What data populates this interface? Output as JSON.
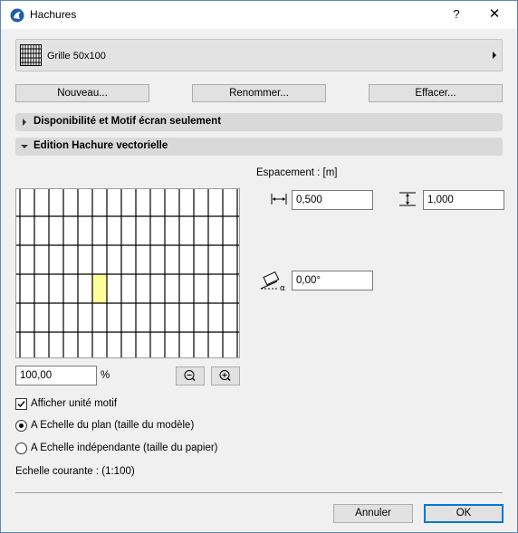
{
  "window": {
    "title": "Hachures",
    "help_label": "?",
    "close_label": "✕"
  },
  "pattern": {
    "name": "Grille 50x100"
  },
  "actions": {
    "new_label": "Nouveau...",
    "rename_label": "Renommer...",
    "delete_label": "Effacer..."
  },
  "sections": {
    "availability": "Disponibilité et Motif écran seulement",
    "vector_edit": "Edition Hachure vectorielle"
  },
  "spacing": {
    "label": "Espacement : [m]",
    "horizontal_value": "0,500",
    "vertical_value": "1,000",
    "angle_value": "0,00°"
  },
  "zoom": {
    "value": "100,00",
    "unit": "%"
  },
  "options": {
    "show_unit_label": "Afficher unité motif",
    "show_unit_checked": true,
    "scale_plan_label": "A Echelle du plan (taille du modèle)",
    "scale_independent_label": "A Echelle indépendante (taille du papier)",
    "selected_scale": "plan",
    "current_scale_label": "Echelle courante : (1:100)"
  },
  "footer": {
    "cancel_label": "Annuler",
    "ok_label": "OK"
  },
  "colors": {
    "highlight_cell": "#ffff99",
    "focus_border": "#0078d7"
  }
}
